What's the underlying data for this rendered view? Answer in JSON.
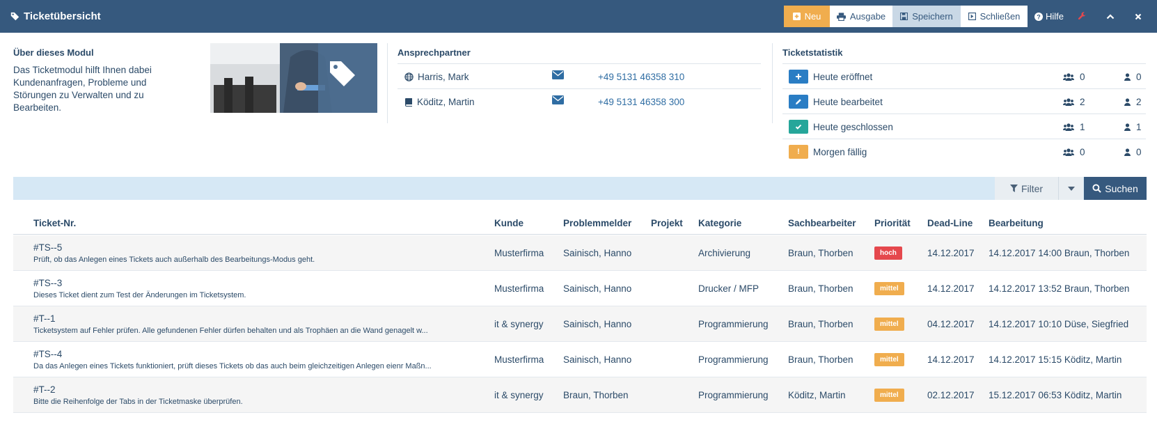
{
  "header": {
    "title": "Ticketübersicht",
    "buttons": {
      "new": "Neu",
      "output": "Ausgabe",
      "save": "Speichern",
      "close": "Schließen",
      "help": "Hilfe"
    }
  },
  "about": {
    "title": "Über dieses Modul",
    "text": "Das Ticketmodul hilft Ihnen dabei Kundenanfragen, Probleme und Störungen zu Verwalten und zu Bearbeiten."
  },
  "contacts": {
    "title": "Ansprechpartner",
    "items": [
      {
        "name": "Harris, Mark",
        "phone": "+49 5131 46358 310",
        "icon": "globe-icon"
      },
      {
        "name": "Köditz, Martin",
        "phone": "+49 5131 46358 300",
        "icon": "book-icon"
      }
    ]
  },
  "stats": {
    "title": "Ticketstatistik",
    "items": [
      {
        "label": "Heute eröffnet",
        "group": "0",
        "user": "0",
        "icon": "plus-icon",
        "color": "#2a7dc4"
      },
      {
        "label": "Heute bearbeitet",
        "group": "2",
        "user": "2",
        "icon": "pencil-icon",
        "color": "#2a7dc4"
      },
      {
        "label": "Heute geschlossen",
        "group": "1",
        "user": "1",
        "icon": "check-icon",
        "color": "#26a69a"
      },
      {
        "label": "Morgen fällig",
        "group": "0",
        "user": "0",
        "icon": "exclamation-icon",
        "color": "#f0ad4e"
      }
    ]
  },
  "toolbar": {
    "filter": "Filter",
    "search": "Suchen"
  },
  "table": {
    "columns": {
      "ticket": "Ticket-Nr.",
      "kunde": "Kunde",
      "problemmelder": "Problemmelder",
      "projekt": "Projekt",
      "kategorie": "Kategorie",
      "sachbearbeiter": "Sachbearbeiter",
      "prioritaet": "Priorität",
      "deadline": "Dead-Line",
      "bearbeitung": "Bearbeitung"
    },
    "rows": [
      {
        "id": "#TS--5",
        "desc": "Prüft, ob das Anlegen eines Tickets auch außerhalb des Bearbeitungs-Modus geht.",
        "kunde": "Musterfirma",
        "problemmelder": "Sainisch, Hanno",
        "projekt": "",
        "kategorie": "Archivierung",
        "sachbearbeiter": "Braun, Thorben",
        "prioritaet": "hoch",
        "deadline": "14.12.2017",
        "bearbeitung": "14.12.2017 14:00 Braun, Thorben"
      },
      {
        "id": "#TS--3",
        "desc": "Dieses Ticket dient zum Test der Änderungen im Ticketsystem.",
        "kunde": "Musterfirma",
        "problemmelder": "Sainisch, Hanno",
        "projekt": "",
        "kategorie": "Drucker / MFP",
        "sachbearbeiter": "Braun, Thorben",
        "prioritaet": "mittel",
        "deadline": "14.12.2017",
        "bearbeitung": "14.12.2017 13:52 Braun, Thorben"
      },
      {
        "id": "#T--1",
        "desc": "Ticketsystem auf Fehler prüfen. Alle gefundenen Fehler dürfen behalten und als Trophäen an die Wand genagelt w...",
        "kunde": "it & synergy",
        "problemmelder": "Sainisch, Hanno",
        "projekt": "",
        "kategorie": "Programmierung",
        "sachbearbeiter": "Braun, Thorben",
        "prioritaet": "mittel",
        "deadline": "04.12.2017",
        "bearbeitung": "14.12.2017 10:10 Düse, Siegfried"
      },
      {
        "id": "#TS--4",
        "desc": "Da das Anlegen eines Tickets funktioniert, prüft dieses Tickets ob das auch beim gleichzeitigen Anlegen eienr Maßn...",
        "kunde": "Musterfirma",
        "problemmelder": "Sainisch, Hanno",
        "projekt": "",
        "kategorie": "Programmierung",
        "sachbearbeiter": "Braun, Thorben",
        "prioritaet": "mittel",
        "deadline": "14.12.2017",
        "bearbeitung": "14.12.2017 15:15 Köditz, Martin"
      },
      {
        "id": "#T--2",
        "desc": "Bitte die Reihenfolge der Tabs in der Ticketmaske überprüfen.",
        "kunde": "it & synergy",
        "problemmelder": "Braun, Thorben",
        "projekt": "",
        "kategorie": "Programmierung",
        "sachbearbeiter": "Köditz, Martin",
        "prioritaet": "mittel",
        "deadline": "02.12.2017",
        "bearbeitung": "15.12.2017 06:53 Köditz, Martin"
      }
    ]
  },
  "colors": {
    "header_bg": "#36597e",
    "accent_orange": "#f0ad4e",
    "priority_high": "#e5484d",
    "priority_medium": "#f0ad4e"
  }
}
